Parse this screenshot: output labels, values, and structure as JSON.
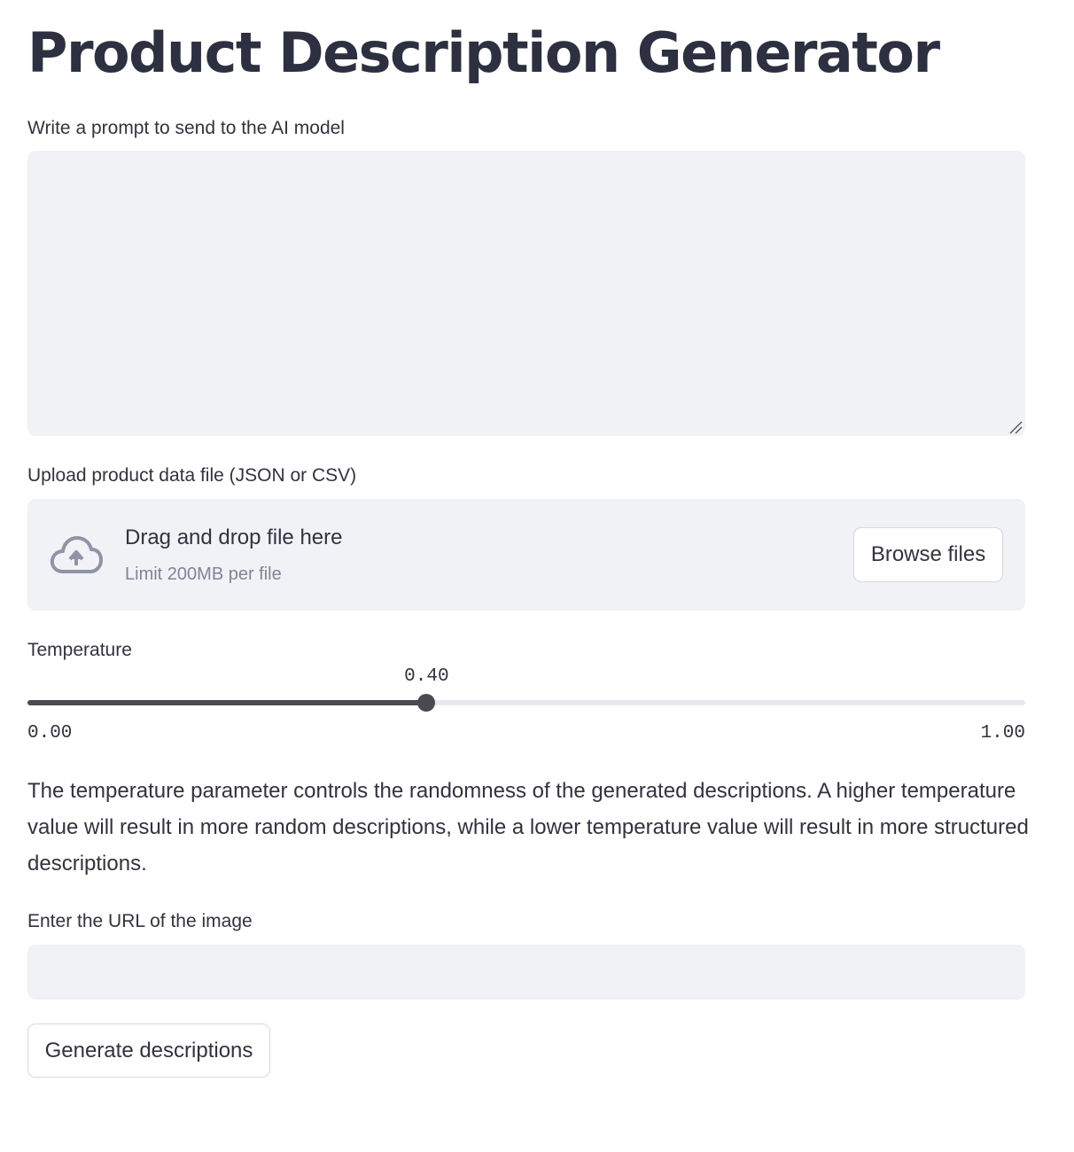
{
  "page": {
    "title": "Product Description Generator"
  },
  "prompt": {
    "label": "Write a prompt to send to the AI model",
    "value": "",
    "placeholder": ""
  },
  "uploader": {
    "label": "Upload product data file (JSON or CSV)",
    "drop_text": "Drag and drop file here",
    "limit_text": "Limit 200MB per file",
    "browse_label": "Browse files",
    "icon": "cloud-upload-icon"
  },
  "temperature": {
    "label": "Temperature",
    "value": 0.4,
    "value_text": "0.40",
    "min_text": "0.00",
    "max_text": "1.00",
    "min": 0.0,
    "max": 1.0
  },
  "description": "The temperature parameter controls the randomness of the generated descriptions. A higher temperature value will result in more random descriptions, while a lower temperature value will result in more structured descriptions.",
  "image_url": {
    "label": "Enter the URL of the image",
    "value": "",
    "placeholder": ""
  },
  "generate": {
    "label": "Generate descriptions"
  },
  "colors": {
    "input_bg": "#f0f2f6",
    "text": "#31333f",
    "muted": "#808495",
    "slider_active": "#4a4b52",
    "slider_track": "#e6e9ef"
  }
}
